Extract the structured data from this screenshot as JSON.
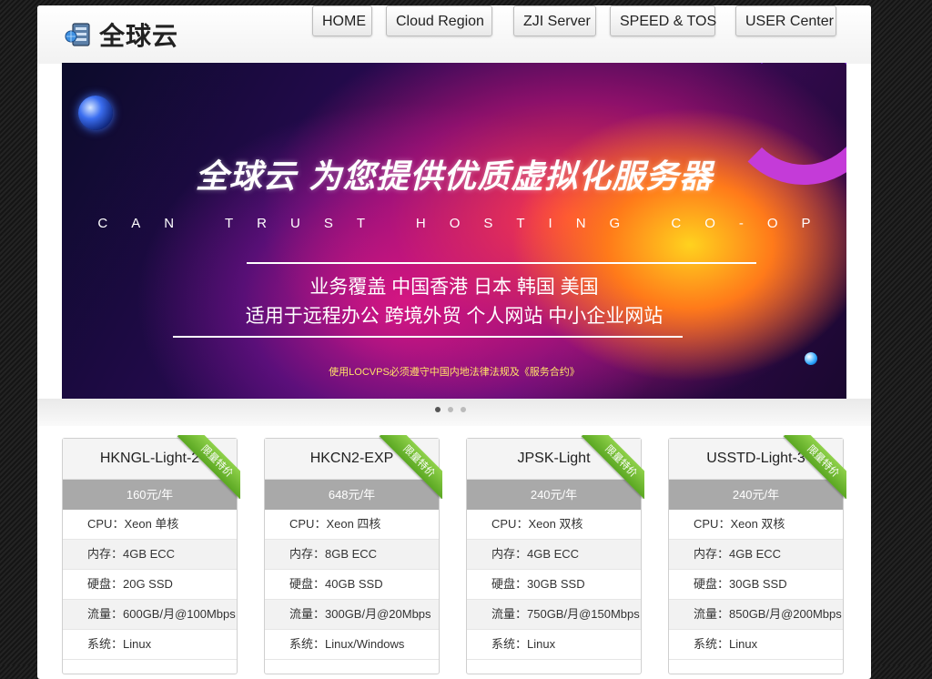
{
  "header": {
    "logo_text": "全球云",
    "nav": [
      {
        "label": "HOME"
      },
      {
        "label": "Cloud Region"
      },
      {
        "label": "ZJI Server"
      },
      {
        "label": "SPEED & TOS"
      },
      {
        "label": "USER Center"
      }
    ]
  },
  "banner": {
    "title": "全球云 为您提供优质虚拟化服务器",
    "subtitle": "CAN TRUST HOSTING CO-OP",
    "line1": "业务覆盖 中国香港 日本 韩国 美国",
    "line2": "适用于远程办公 跨境外贸 个人网站 中小企业网站",
    "notice": "使用LOCVPS必须遵守中国内地法律法规及《服务合约》",
    "slide_count": 3,
    "active_slide": 1
  },
  "plans": [
    {
      "name": "HKNGL-Light-2",
      "ribbon": "限量特价",
      "price": "160元/年",
      "specs": [
        "CPU：Xeon 单核",
        "内存：4GB ECC",
        "硬盘：20G SSD",
        "流量：600GB/月@100Mbps",
        "系统：Linux"
      ]
    },
    {
      "name": "HKCN2-EXP",
      "ribbon": "限量特价",
      "price": "648元/年",
      "specs": [
        "CPU：Xeon 四核",
        "内存：8GB ECC",
        "硬盘：40GB SSD",
        "流量：300GB/月@20Mbps",
        "系统：Linux/Windows"
      ]
    },
    {
      "name": "JPSK-Light",
      "ribbon": "限量特价",
      "price": "240元/年",
      "specs": [
        "CPU：Xeon 双核",
        "内存：4GB ECC",
        "硬盘：30GB SSD",
        "流量：750GB/月@150Mbps",
        "系统：Linux"
      ]
    },
    {
      "name": "USSTD-Light-3",
      "ribbon": "限量特价",
      "price": "240元/年",
      "specs": [
        "CPU：Xeon 双核",
        "内存：4GB ECC",
        "硬盘：30GB SSD",
        "流量：850GB/月@200Mbps",
        "系统：Linux"
      ]
    }
  ],
  "colors": {
    "ribbon": "#6bb82c",
    "price_bar": "#a9a9a9",
    "background": "#1b1b1b"
  }
}
